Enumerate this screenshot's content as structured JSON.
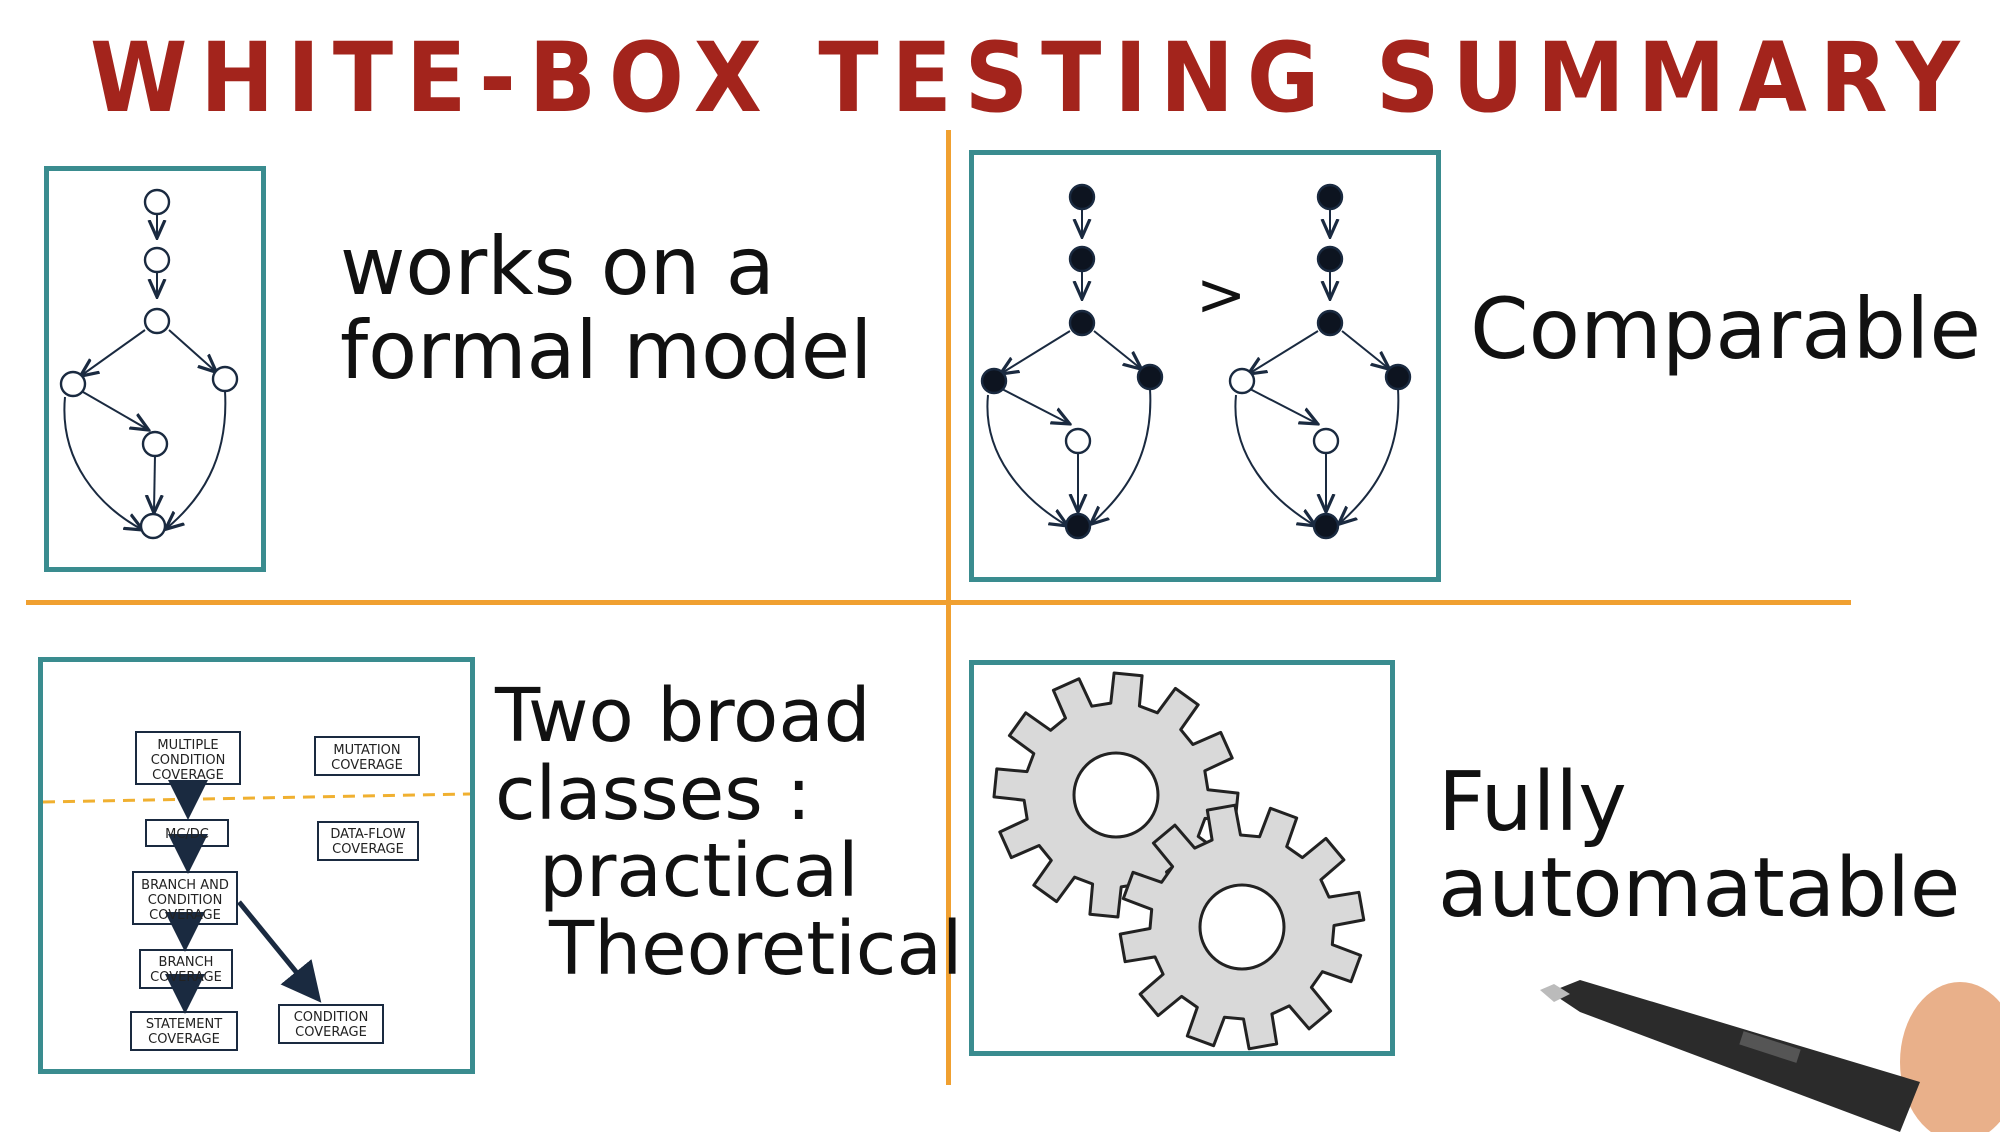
{
  "title": "WHITE-BOX TESTING SUMMARY",
  "colors": {
    "title": "#a3241c",
    "divider": "#f0a030",
    "panel_border": "#3a8c8f",
    "ink": "#111111",
    "gear_fill": "#d9d9d9",
    "dashed": "#f0b030"
  },
  "quadrants": {
    "top_left": {
      "lines": [
        "works on a",
        "formal model"
      ]
    },
    "top_right": {
      "comparison_symbol": ">",
      "lines": [
        "Comparable"
      ]
    },
    "bottom_left": {
      "lines": [
        "Two broad",
        "classes :",
        "practical",
        "Theoretical"
      ],
      "hierarchy": {
        "multiple_condition": [
          "MULTIPLE",
          "CONDITION",
          "COVERAGE"
        ],
        "mutation": [
          "MUTATION",
          "COVERAGE"
        ],
        "mcdc": [
          "MC/DC"
        ],
        "data_flow": [
          "DATA-FLOW",
          "COVERAGE"
        ],
        "branch_and_condition": [
          "BRANCH AND",
          "CONDITION",
          "COVERAGE"
        ],
        "branch": [
          "BRANCH",
          "COVERAGE"
        ],
        "statement": [
          "STATEMENT",
          "COVERAGE"
        ],
        "condition": [
          "CONDITION",
          "COVERAGE"
        ]
      }
    },
    "bottom_right": {
      "icon": "gears-icon",
      "lines": [
        "Fully",
        "automatable"
      ]
    }
  },
  "pen_icon": "pen-icon"
}
